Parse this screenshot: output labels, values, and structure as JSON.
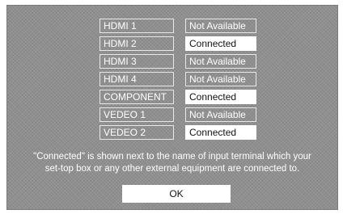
{
  "inputs": [
    {
      "name": "HDMI 1",
      "status": "Not Available"
    },
    {
      "name": "HDMI 2",
      "status": "Connected"
    },
    {
      "name": "HDMI 3",
      "status": "Not Available"
    },
    {
      "name": "HDMI 4",
      "status": "Not Available"
    },
    {
      "name": "COMPONENT",
      "status": "Connected"
    },
    {
      "name": "VEDEO 1",
      "status": "Not Available"
    },
    {
      "name": "VEDEO 2",
      "status": "Connected"
    }
  ],
  "note_line1": "\"Connected\" is shown next to the name of input terminal which your",
  "note_line2": "set-top box or any other external equipment are connected to.",
  "ok_label": "OK"
}
